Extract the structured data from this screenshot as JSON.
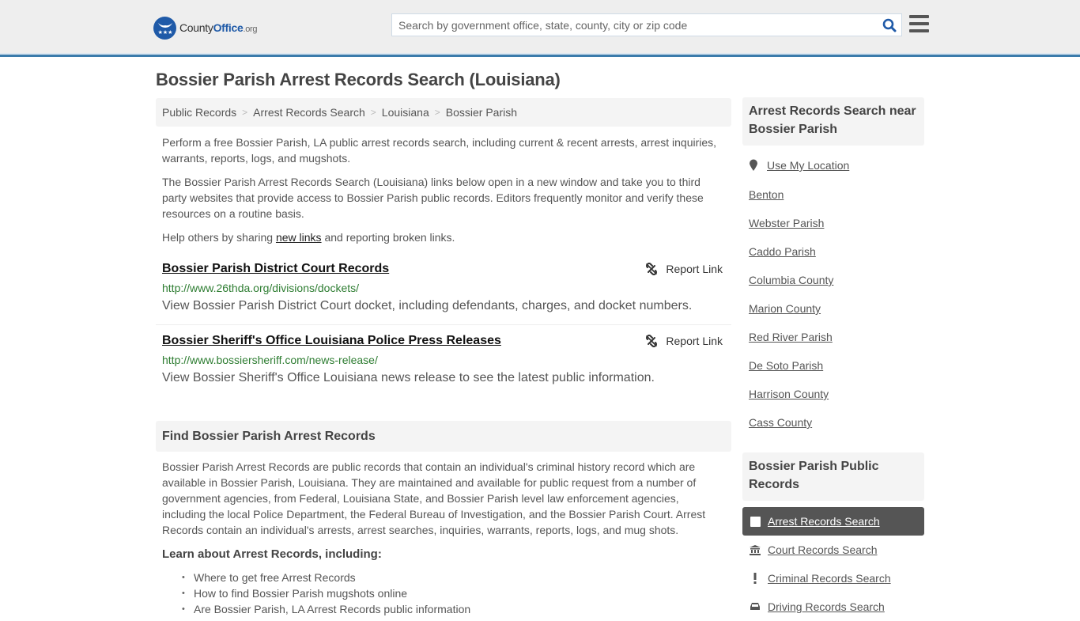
{
  "header": {
    "logo_name": "County",
    "logo_bold": "Office",
    "logo_tld": ".org",
    "search_placeholder": "Search by government office, state, county, city or zip code",
    "search_value": "",
    "icons": {
      "search": "search-icon",
      "menu": "hamburger-menu-icon",
      "logo": "eagle-stars-logo-icon"
    },
    "accent_color": "#3b7bab",
    "brand_color": "#1f5aa8"
  },
  "page": {
    "title": "Bossier Parish Arrest Records Search (Louisiana)"
  },
  "breadcrumb": [
    {
      "label": "Public Records"
    },
    {
      "label": "Arrest Records Search"
    },
    {
      "label": "Louisiana"
    },
    {
      "label": "Bossier Parish"
    }
  ],
  "breadcrumb_separator": ">",
  "intro": {
    "p1": "Perform a free Bossier Parish, LA public arrest records search, including current & recent arrests, arrest inquiries, warrants, reports, logs, and mugshots.",
    "p2": "The Bossier Parish Arrest Records Search (Louisiana) links below open in a new window and take you to third party websites that provide access to Bossier Parish public records. Editors frequently monitor and verify these resources on a routine basis.",
    "p3_before": "Help others by sharing ",
    "p3_link": "new links",
    "p3_after": " and reporting broken links."
  },
  "results": [
    {
      "title": "Bossier Parish District Court Records",
      "url": "http://www.26thda.org/divisions/dockets/",
      "description": "View Bossier Parish District Court docket, including defendants, charges, and docket numbers.",
      "report_label": "Report Link"
    },
    {
      "title": "Bossier Sheriff's Office Louisiana Police Press Releases",
      "url": "http://www.bossiersheriff.com/news-release/",
      "description": "View Bossier Sheriff's Office Louisiana news release to see the latest public information.",
      "report_label": "Report Link"
    }
  ],
  "find_section": {
    "heading": "Find Bossier Parish Arrest Records",
    "body": "Bossier Parish Arrest Records are public records that contain an individual's criminal history record which are available in Bossier Parish, Louisiana. They are maintained and available for public request from a number of government agencies, from Federal, Louisiana State, and Bossier Parish level law enforcement agencies, including the local Police Department, the Federal Bureau of Investigation, and the Bossier Parish Court. Arrest Records contain an individual's arrests, arrest searches, inquiries, warrants, reports, logs, and mug shots.",
    "learn_heading": "Learn about Arrest Records, including:",
    "learn_items": [
      "Where to get free Arrest Records",
      "How to find Bossier Parish mugshots online",
      "Are Bossier Parish, LA Arrest Records public information"
    ]
  },
  "sidebar": {
    "nearby_heading": "Arrest Records Search near Bossier Parish",
    "use_location": "Use My Location",
    "nearby": [
      "Benton",
      "Webster Parish",
      "Caddo Parish",
      "Columbia County",
      "Marion County",
      "Red River Parish",
      "De Soto Parish",
      "Harrison County",
      "Cass County"
    ],
    "records_heading": "Bossier Parish Public Records",
    "records": [
      {
        "label": "Arrest Records Search",
        "icon": "square-icon",
        "active": true
      },
      {
        "label": "Court Records Search",
        "icon": "courthouse-icon",
        "active": false
      },
      {
        "label": "Criminal Records Search",
        "icon": "exclamation-icon",
        "active": false
      },
      {
        "label": "Driving Records Search",
        "icon": "car-icon",
        "active": false
      }
    ]
  }
}
